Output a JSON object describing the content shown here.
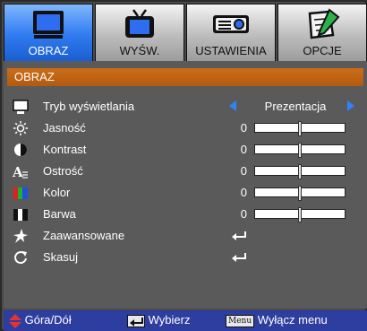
{
  "tabs": [
    {
      "label": "OBRAZ",
      "icon": "monitor-icon",
      "active": true
    },
    {
      "label": "WYŚW.",
      "icon": "tv-icon",
      "active": false
    },
    {
      "label": "USTAWIENIA",
      "icon": "projector-icon",
      "active": false
    },
    {
      "label": "OPCJE",
      "icon": "notepad-pencil-icon",
      "active": false
    }
  ],
  "section": {
    "title": "OBRAZ"
  },
  "rows": {
    "display_mode": {
      "label": "Tryb wyświetlania",
      "value": "Prezentacja",
      "icon": "display-mode-icon"
    },
    "brightness": {
      "label": "Jasność",
      "value": "0",
      "icon": "brightness-icon"
    },
    "contrast": {
      "label": "Kontrast",
      "value": "0",
      "icon": "contrast-icon"
    },
    "sharpness": {
      "label": "Ostrość",
      "value": "0",
      "icon": "sharpness-icon"
    },
    "color": {
      "label": "Kolor",
      "value": "0",
      "icon": "color-icon"
    },
    "tint": {
      "label": "Barwa",
      "value": "0",
      "icon": "tint-icon"
    },
    "advanced": {
      "label": "Zaawansowane",
      "icon": "advanced-icon"
    },
    "reset": {
      "label": "Skasuj",
      "icon": "reset-icon"
    }
  },
  "slider_position_fraction": 0.5,
  "footer": {
    "updown": "Góra/Dół",
    "select": "Wybierz",
    "menu_key": "Menu",
    "exit": "Wyłącz menu"
  },
  "colors": {
    "active_tab": "#2f7bf0",
    "section_header": "#cc6e18",
    "footer": "#2e3ea0",
    "arrow": "#2d84ff",
    "footer_updown": "#e83232"
  }
}
